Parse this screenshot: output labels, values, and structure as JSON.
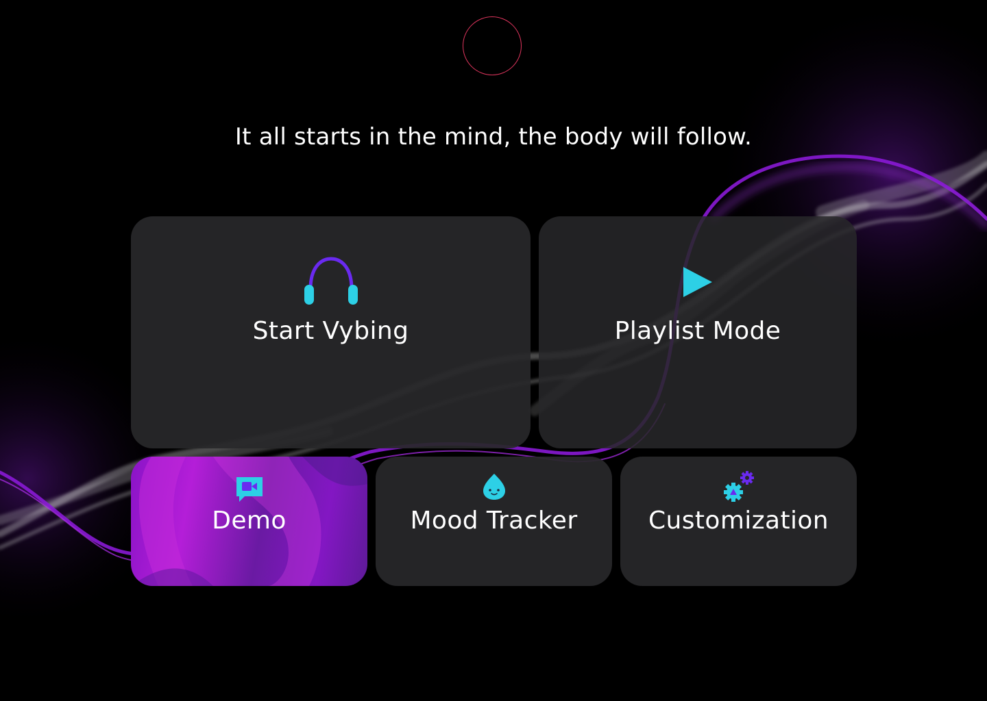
{
  "tagline": "It all starts in the mind, the body will follow.",
  "colors": {
    "background": "#000000",
    "card": "#28282a",
    "accent_purple": "#8a1ad6",
    "accent_cyan": "#2dd0e6",
    "logo_ring": "#e2365f"
  },
  "cards": {
    "start_vybing": {
      "label": "Start Vybing",
      "icon": "headphones-icon"
    },
    "playlist_mode": {
      "label": "Playlist Mode",
      "icon": "play-icon"
    },
    "demo": {
      "label": "Demo",
      "icon": "video-chat-icon"
    },
    "mood_tracker": {
      "label": "Mood Tracker",
      "icon": "droplet-face-icon"
    },
    "customization": {
      "label": "Customization",
      "icon": "gears-icon"
    }
  }
}
